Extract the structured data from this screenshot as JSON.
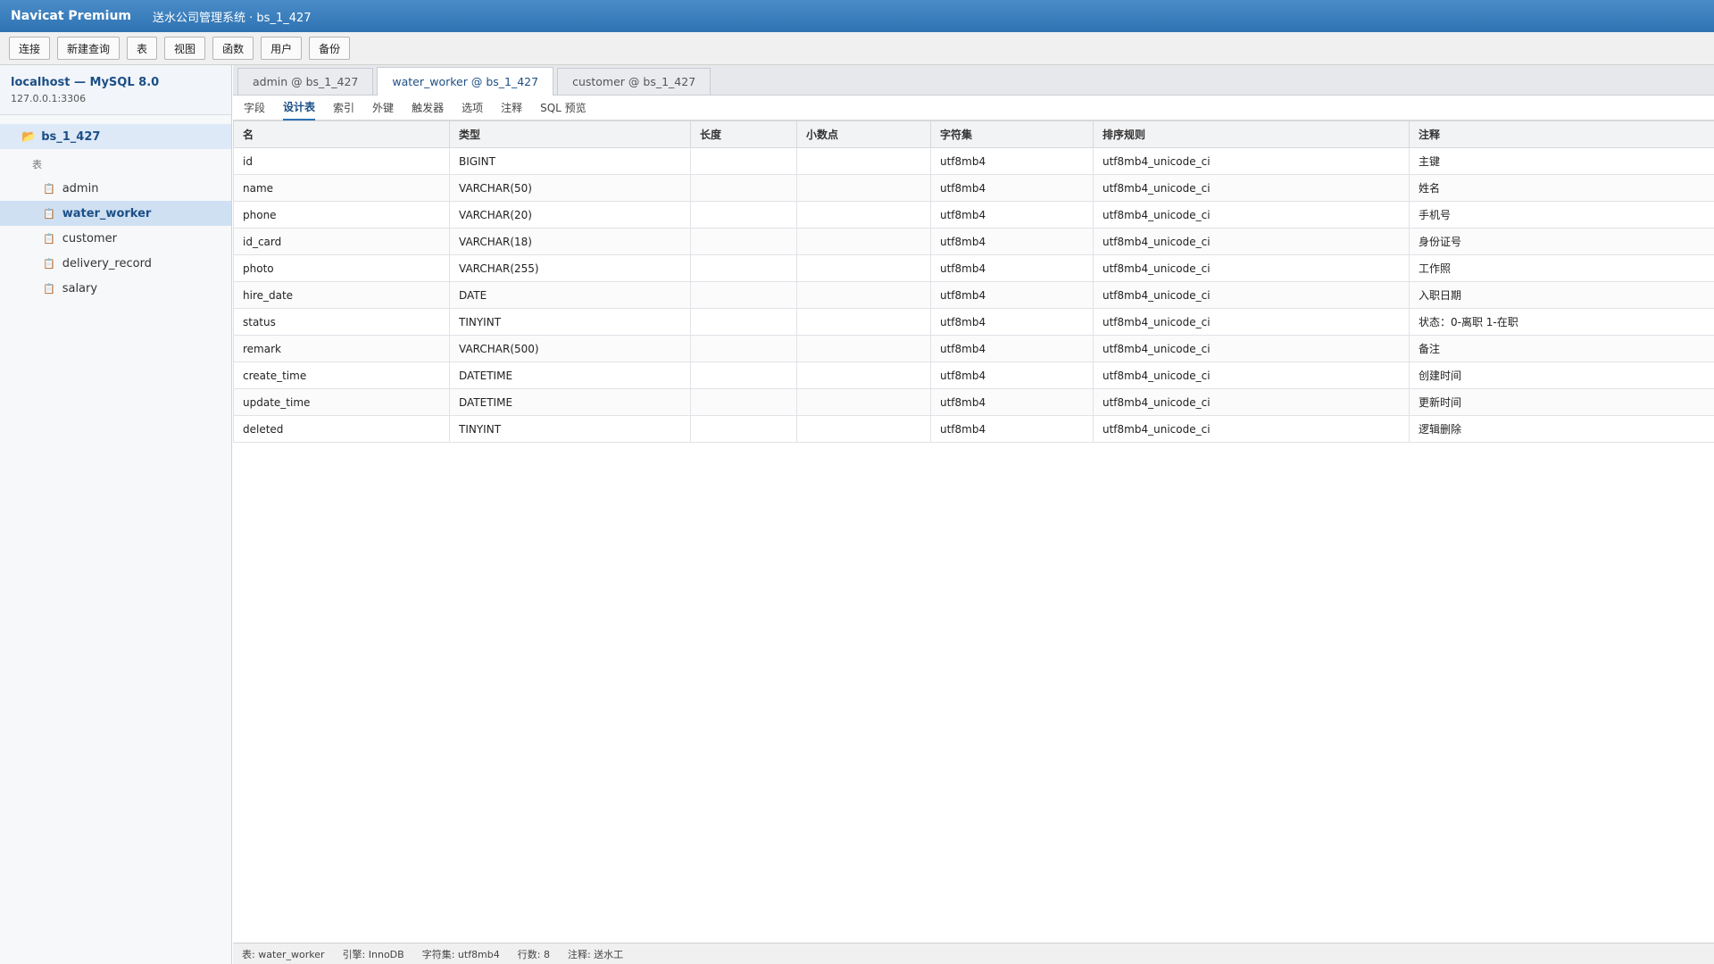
{
  "window": {
    "app_name": "Navicat Premium",
    "doc_title": "送水公司管理系统 · bs_1_427"
  },
  "toolbar": {
    "buttons": [
      "连接",
      "新建查询",
      "表",
      "视图",
      "函数",
      "用户",
      "备份"
    ]
  },
  "sidebar": {
    "connection_name": "localhost — MySQL 8.0",
    "connection_addr": "127.0.0.1:3306",
    "database": "bs_1_427",
    "group_label": "表",
    "tables": [
      "admin",
      "water_worker",
      "customer",
      "delivery_record",
      "salary"
    ],
    "selected_table": "water_worker"
  },
  "tabs": [
    "admin @ bs_1_427",
    "water_worker @ bs_1_427",
    "customer @ bs_1_427"
  ],
  "active_tab": "water_worker @ bs_1_427",
  "subtabs": [
    "字段",
    "设计表",
    "索引",
    "外键",
    "触发器",
    "选项",
    "注释",
    "SQL 预览"
  ],
  "active_subtab": "设计表",
  "grid": {
    "columns": [
      "名",
      "类型",
      "长度",
      "小数点",
      "字符集",
      "排序规则",
      "注释"
    ],
    "rows": [
      [
        "id",
        "BIGINT",
        "",
        "",
        "utf8mb4",
        "utf8mb4_unicode_ci",
        "主键"
      ],
      [
        "name",
        "VARCHAR(50)",
        "",
        "",
        "utf8mb4",
        "utf8mb4_unicode_ci",
        "姓名"
      ],
      [
        "phone",
        "VARCHAR(20)",
        "",
        "",
        "utf8mb4",
        "utf8mb4_unicode_ci",
        "手机号"
      ],
      [
        "id_card",
        "VARCHAR(18)",
        "",
        "",
        "utf8mb4",
        "utf8mb4_unicode_ci",
        "身份证号"
      ],
      [
        "photo",
        "VARCHAR(255)",
        "",
        "",
        "utf8mb4",
        "utf8mb4_unicode_ci",
        "工作照"
      ],
      [
        "hire_date",
        "DATE",
        "",
        "",
        "utf8mb4",
        "utf8mb4_unicode_ci",
        "入职日期"
      ],
      [
        "status",
        "TINYINT",
        "",
        "",
        "utf8mb4",
        "utf8mb4_unicode_ci",
        "状态：0-离职 1-在职"
      ],
      [
        "remark",
        "VARCHAR(500)",
        "",
        "",
        "utf8mb4",
        "utf8mb4_unicode_ci",
        "备注"
      ],
      [
        "create_time",
        "DATETIME",
        "",
        "",
        "utf8mb4",
        "utf8mb4_unicode_ci",
        "创建时间"
      ],
      [
        "update_time",
        "DATETIME",
        "",
        "",
        "utf8mb4",
        "utf8mb4_unicode_ci",
        "更新时间"
      ],
      [
        "deleted",
        "TINYINT",
        "",
        "",
        "utf8mb4",
        "utf8mb4_unicode_ci",
        "逻辑删除"
      ]
    ]
  },
  "status_bar": [
    "表: water_worker",
    "引擎: InnoDB",
    "字符集: utf8mb4",
    "行数: 8",
    "注释: 送水工"
  ]
}
